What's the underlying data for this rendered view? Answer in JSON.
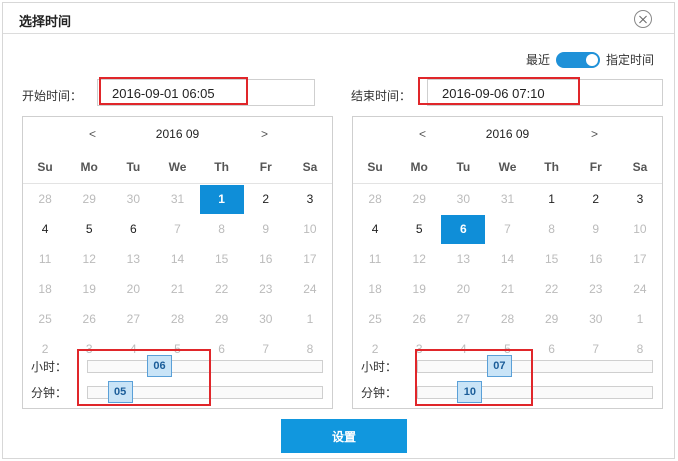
{
  "dialog": {
    "title": "选择时间",
    "close_icon": "close-circle-icon"
  },
  "mode": {
    "left_label": "最近",
    "right_label": "指定时间",
    "toggle_on": true
  },
  "start": {
    "label": "开始时间：",
    "value": "2016-09-01 06:05"
  },
  "end": {
    "label": "结束时间：",
    "value": "2016-09-06 07:10"
  },
  "calendar_left": {
    "prev": "<",
    "next": ">",
    "month_label": "2016 09",
    "weekdays": [
      "Su",
      "Mo",
      "Tu",
      "We",
      "Th",
      "Fr",
      "Sa"
    ],
    "days": [
      [
        28,
        29,
        30,
        31,
        1,
        2,
        3
      ],
      [
        4,
        5,
        6,
        7,
        8,
        9,
        10
      ],
      [
        11,
        12,
        13,
        14,
        15,
        16,
        17
      ],
      [
        18,
        19,
        20,
        21,
        22,
        23,
        24
      ],
      [
        25,
        26,
        27,
        28,
        29,
        30,
        1
      ],
      [
        2,
        3,
        4,
        5,
        6,
        7,
        8
      ]
    ],
    "current_month_days": [
      1,
      2,
      3,
      4,
      5,
      6
    ],
    "selected_day": 1,
    "hour_label": "小时：",
    "hour_value": "06",
    "hour_pos": 0.25,
    "minute_label": "分钟：",
    "minute_value": "05",
    "minute_pos": 0.083
  },
  "calendar_right": {
    "prev": "<",
    "next": ">",
    "month_label": "2016 09",
    "weekdays": [
      "Su",
      "Mo",
      "Tu",
      "We",
      "Th",
      "Fr",
      "Sa"
    ],
    "days": [
      [
        28,
        29,
        30,
        31,
        1,
        2,
        3
      ],
      [
        4,
        5,
        6,
        7,
        8,
        9,
        10
      ],
      [
        11,
        12,
        13,
        14,
        15,
        16,
        17
      ],
      [
        18,
        19,
        20,
        21,
        22,
        23,
        24
      ],
      [
        25,
        26,
        27,
        28,
        29,
        30,
        1
      ],
      [
        2,
        3,
        4,
        5,
        6,
        7,
        8
      ]
    ],
    "current_month_days": [
      1,
      2,
      3,
      4,
      5,
      6
    ],
    "selected_day": 6,
    "hour_label": "小时：",
    "hour_value": "07",
    "hour_pos": 0.292,
    "minute_label": "分钟：",
    "minute_value": "10",
    "minute_pos": 0.167
  },
  "set_button": "设置"
}
